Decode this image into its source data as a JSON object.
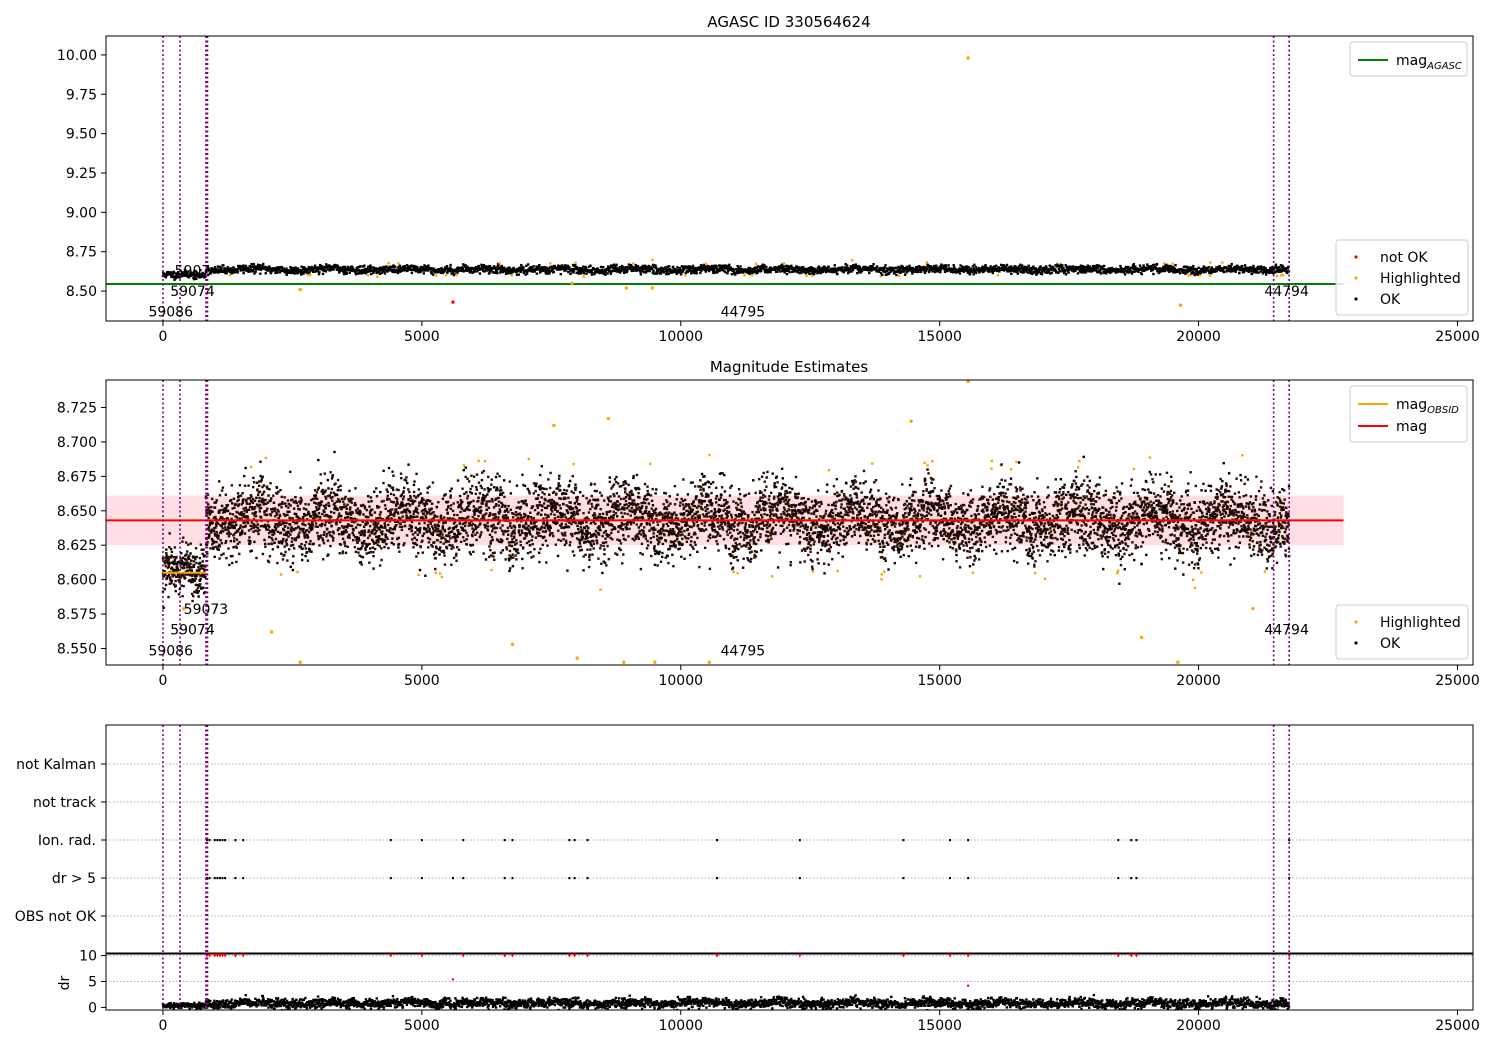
{
  "colors": {
    "ok": "#000000",
    "highlighted": "#ffa500",
    "not_ok": "#ff0000",
    "agasc_line": "#008000",
    "obsid_line": "#ffa500",
    "mag_line": "#ff0000",
    "mag_band": "#ffc0c8",
    "obs_boundary": "#800080",
    "grid": "#b0b0b0"
  },
  "chart_data": [
    {
      "id": "agasc",
      "type": "scatter",
      "title": "AGASC ID 330564624",
      "xlim": [
        -1100,
        25300
      ],
      "ylim": [
        8.31,
        10.12
      ],
      "xticks": [
        0,
        5000,
        10000,
        15000,
        20000,
        25000
      ],
      "yticks": [
        8.5,
        8.75,
        9.0,
        9.25,
        9.5,
        9.75,
        10.0
      ],
      "ytick_labels": [
        "8.50",
        "8.75",
        "9.00",
        "9.25",
        "9.50",
        "9.75",
        "10.00"
      ],
      "mag_agasc": 8.545,
      "obs_boundaries": [
        0,
        330,
        830,
        840,
        850,
        860,
        21450,
        21750
      ],
      "obs_labels": [
        {
          "text": "59086",
          "x": 150,
          "y": 8.34
        },
        {
          "text": "59074",
          "x": 570,
          "y": 8.47
        },
        {
          "text": "5907",
          "x": 570,
          "y": 8.6
        },
        {
          "text": "44795",
          "x": 11200,
          "y": 8.34
        },
        {
          "text": "44794",
          "x": 21700,
          "y": 8.47
        }
      ],
      "legend_lines": [
        {
          "label": "mag",
          "subscript": "AGASC",
          "color": "#008000"
        }
      ],
      "legend_points": [
        {
          "label": "not OK",
          "color": "#ff0000"
        },
        {
          "label": "Highlighted",
          "color": "#ffa500"
        },
        {
          "label": "OK",
          "color": "#000000"
        }
      ],
      "segments": [
        {
          "x0": 0,
          "x1": 820,
          "mean": 8.6,
          "spread": 0.012
        },
        {
          "x0": 830,
          "x1": 21750,
          "mean": 8.637,
          "spread": 0.013
        }
      ],
      "highlighted_points": [
        {
          "x": 15550,
          "y": 9.98
        },
        {
          "x": 19650,
          "y": 8.41
        },
        {
          "x": 9450,
          "y": 8.52
        },
        {
          "x": 8950,
          "y": 8.52
        },
        {
          "x": 2650,
          "y": 8.51
        },
        {
          "x": 7900,
          "y": 8.55
        }
      ],
      "not_ok_points": [
        {
          "x": 5600,
          "y": 8.43
        }
      ]
    },
    {
      "id": "estimates",
      "type": "scatter",
      "title": "Magnitude Estimates",
      "xlim": [
        -1100,
        25300
      ],
      "ylim": [
        8.538,
        8.745
      ],
      "xticks": [
        0,
        5000,
        10000,
        15000,
        20000,
        25000
      ],
      "yticks": [
        8.55,
        8.575,
        8.6,
        8.625,
        8.65,
        8.675,
        8.7,
        8.725
      ],
      "ytick_labels": [
        "8.550",
        "8.575",
        "8.600",
        "8.625",
        "8.650",
        "8.675",
        "8.700",
        "8.725"
      ],
      "mag": 8.643,
      "mag_band": [
        8.625,
        8.661
      ],
      "obsid_mags": [
        {
          "x0": 0,
          "x1": 820,
          "mag": 8.605
        },
        {
          "x0": 830,
          "x1": 21750,
          "mag": 8.643
        }
      ],
      "obs_boundaries": [
        0,
        330,
        830,
        840,
        850,
        860,
        21450,
        21750
      ],
      "obs_labels": [
        {
          "text": "59086",
          "x": 150,
          "y": 8.545
        },
        {
          "text": "59074",
          "x": 570,
          "y": 8.56
        },
        {
          "text": "59073",
          "x": 830,
          "y": 8.575
        },
        {
          "text": "44795",
          "x": 11200,
          "y": 8.545
        },
        {
          "text": "44794",
          "x": 21700,
          "y": 8.56
        }
      ],
      "legend_lines": [
        {
          "label": "mag",
          "subscript": "OBSID",
          "color": "#ffa500"
        },
        {
          "label": "mag",
          "subscript": "",
          "color": "#ff0000"
        }
      ],
      "legend_points": [
        {
          "label": "Highlighted",
          "color": "#ffa500"
        },
        {
          "label": "OK",
          "color": "#000000"
        }
      ],
      "segments": [
        {
          "x0": 0,
          "x1": 820,
          "mean": 8.604,
          "spread": 0.008
        },
        {
          "x0": 830,
          "x1": 21750,
          "mean": 8.643,
          "spread": 0.013
        }
      ],
      "highlighted_points": [
        {
          "x": 15550,
          "y": 8.744
        },
        {
          "x": 2650,
          "y": 8.54
        },
        {
          "x": 8900,
          "y": 8.54
        },
        {
          "x": 9500,
          "y": 8.54
        },
        {
          "x": 10550,
          "y": 8.54
        },
        {
          "x": 19600,
          "y": 8.54
        },
        {
          "x": 2100,
          "y": 8.562
        },
        {
          "x": 6750,
          "y": 8.553
        },
        {
          "x": 8000,
          "y": 8.543
        },
        {
          "x": 18900,
          "y": 8.558
        },
        {
          "x": 21050,
          "y": 8.579
        },
        {
          "x": 14450,
          "y": 8.715
        },
        {
          "x": 8600,
          "y": 8.717
        },
        {
          "x": 7550,
          "y": 8.712
        },
        {
          "x": 400,
          "y": 8.579
        }
      ]
    },
    {
      "id": "flags",
      "type": "scatter",
      "xlim": [
        -1100,
        25300
      ],
      "categories": [
        "not Kalman",
        "not track",
        "Ion. rad.",
        "dr > 5",
        "OBS not OK"
      ],
      "obs_boundaries": [
        0,
        330,
        830,
        840,
        850,
        860,
        21450,
        21750
      ],
      "flag_events": [
        {
          "category": "Ion. rad.",
          "x": [
            850,
            900,
            1000,
            1050,
            1100,
            1150,
            1200,
            1400,
            1550,
            4400,
            5000,
            5800,
            6600,
            6750,
            7850,
            7950,
            8200,
            10700,
            12300,
            14300,
            15200,
            15550,
            18450,
            18700,
            18800,
            21750
          ]
        },
        {
          "category": "dr > 5",
          "x": [
            850,
            900,
            1000,
            1050,
            1100,
            1150,
            1200,
            1400,
            1550,
            4400,
            5000,
            5600,
            5800,
            6600,
            6750,
            7850,
            7950,
            8200,
            10700,
            12300,
            14300,
            15200,
            15550,
            18450,
            18700,
            18800,
            21750
          ]
        }
      ]
    },
    {
      "id": "dr",
      "type": "scatter",
      "ylabel": "dr",
      "xlim": [
        -1100,
        25300
      ],
      "ylim": [
        -0.5,
        10.5
      ],
      "xticks": [
        0,
        5000,
        10000,
        15000,
        20000,
        25000
      ],
      "yticks": [
        0,
        5,
        10
      ],
      "ytick_labels": [
        "0",
        "5",
        "10"
      ],
      "obs_boundaries": [
        0,
        330,
        830,
        840,
        850,
        860,
        21450,
        21750
      ],
      "segments": [
        {
          "x0": 0,
          "x1": 820,
          "mean": 0.3,
          "spread": 0.25
        },
        {
          "x0": 830,
          "x1": 21750,
          "mean": 0.8,
          "spread": 0.45
        }
      ],
      "clipped_x": [
        850,
        900,
        1000,
        1050,
        1100,
        1150,
        1200,
        1400,
        1550,
        4400,
        5000,
        5800,
        6600,
        6750,
        7850,
        7950,
        8200,
        10700,
        12300,
        14300,
        15200,
        15550,
        18450,
        18700,
        18800,
        21750
      ],
      "outliers": [
        {
          "x": 5600,
          "y": 5.4
        },
        {
          "x": 15550,
          "y": 4.2
        }
      ]
    }
  ]
}
